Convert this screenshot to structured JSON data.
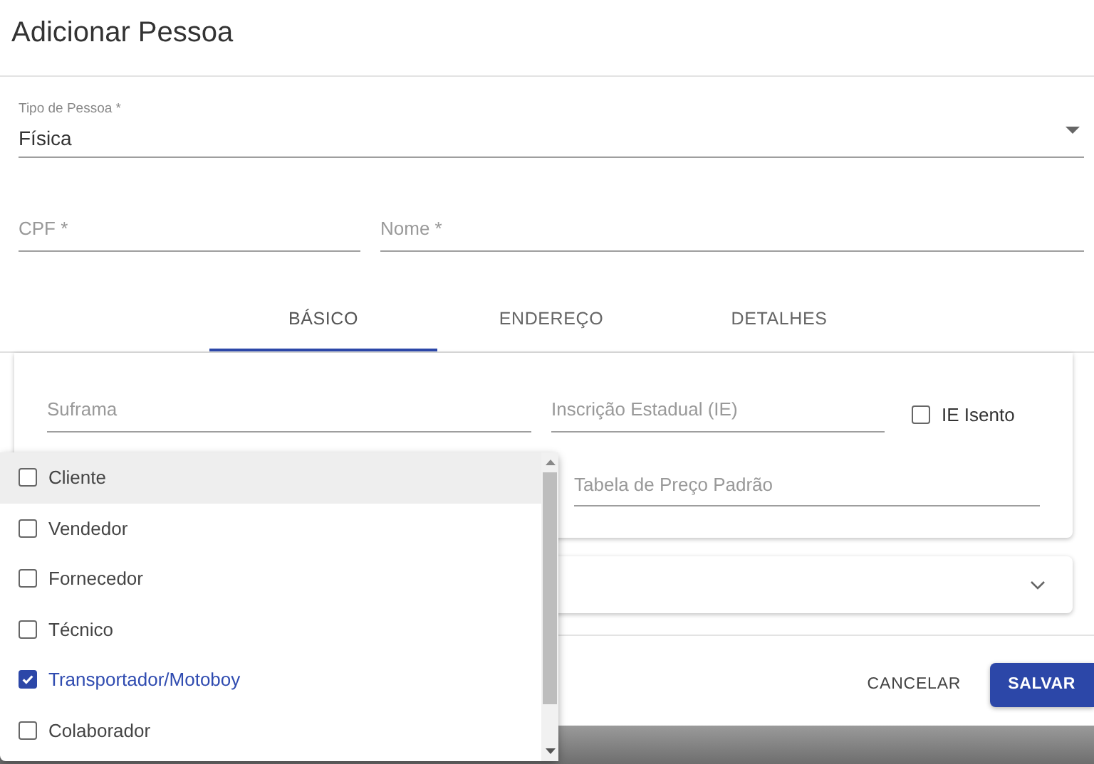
{
  "dialog": {
    "title": "Adicionar Pessoa"
  },
  "tipo_pessoa": {
    "label": "Tipo de Pessoa *",
    "value": "Física"
  },
  "fields": [
    {
      "placeholder": "CPF *"
    },
    {
      "placeholder": "Nome *"
    }
  ],
  "tabs": [
    {
      "label": "BÁSICO",
      "selected": true
    },
    {
      "label": "ENDEREÇO",
      "selected": false
    },
    {
      "label": "DETALHES",
      "selected": false
    }
  ],
  "basico": {
    "fields": [
      {
        "placeholder": "Suframa"
      },
      {
        "placeholder": "Inscrição Estadual (IE)"
      }
    ],
    "ie_isento": {
      "label": "IE Isento",
      "checked": false
    },
    "tabela": {
      "placeholder": "Tabela de Preço Padrão"
    }
  },
  "collapsed_panel": {
    "expanded": false
  },
  "buttons": [
    {
      "label": "CANCELAR",
      "kind": "text"
    },
    {
      "label": "SALVAR",
      "kind": "primary"
    }
  ],
  "papeis_menu": {
    "options": [
      {
        "label": "Cliente",
        "checked": false,
        "highlighted": true
      },
      {
        "label": "Vendedor",
        "checked": false,
        "highlighted": false
      },
      {
        "label": "Fornecedor",
        "checked": false,
        "highlighted": false
      },
      {
        "label": "Técnico",
        "checked": false,
        "highlighted": false
      },
      {
        "label": "Transportador/Motoboy",
        "checked": true,
        "highlighted": false
      },
      {
        "label": "Colaborador",
        "checked": false,
        "highlighted": false
      }
    ]
  }
}
